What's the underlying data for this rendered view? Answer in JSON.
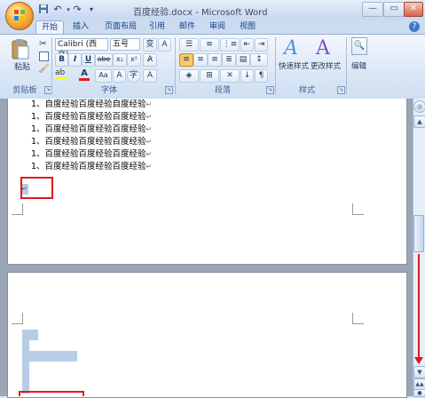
{
  "window": {
    "title": "百度经验.docx - Microsoft Word",
    "controls": {
      "minimize": "—",
      "maximize": "▭",
      "close": "✕"
    }
  },
  "qat": {
    "save_icon": "save-icon",
    "undo_icon": "undo-icon",
    "redo_icon": "redo-icon"
  },
  "tabs": [
    {
      "label": "开始",
      "active": true
    },
    {
      "label": "插入"
    },
    {
      "label": "页面布局"
    },
    {
      "label": "引用"
    },
    {
      "label": "邮件"
    },
    {
      "label": "审阅"
    },
    {
      "label": "视图"
    }
  ],
  "ribbon": {
    "clipboard": {
      "paste_label": "粘贴",
      "group_label": "剪贴板"
    },
    "font": {
      "font_name": "Calibri (西文) ",
      "font_size": "五号",
      "bold": "B",
      "italic": "I",
      "underline": "U",
      "strike": "abe",
      "subscript": "x₂",
      "superscript": "x²",
      "font_color": "A",
      "change_case": "Aa",
      "group_label": "字体"
    },
    "paragraph": {
      "group_label": "段落"
    },
    "styles": {
      "quick_styles_label": "快速样式",
      "change_styles_label": "更改样式",
      "group_label": "样式"
    },
    "editing": {
      "label": "编辑"
    }
  },
  "document": {
    "page1_lines": [
      "1、自度经验百度经验自度经验",
      "1、百度经验百度经验百度经验",
      "1、百度经验百度经验百度经验",
      "1、百度经验百度经验百度经验",
      "1、百度经验百度经验百度经验",
      "1、百度经验百度经验百度经验"
    ],
    "paragraph_mark": "↵"
  },
  "colors": {
    "annotation_red": "#e0181b",
    "selection": "#b8cde5"
  }
}
